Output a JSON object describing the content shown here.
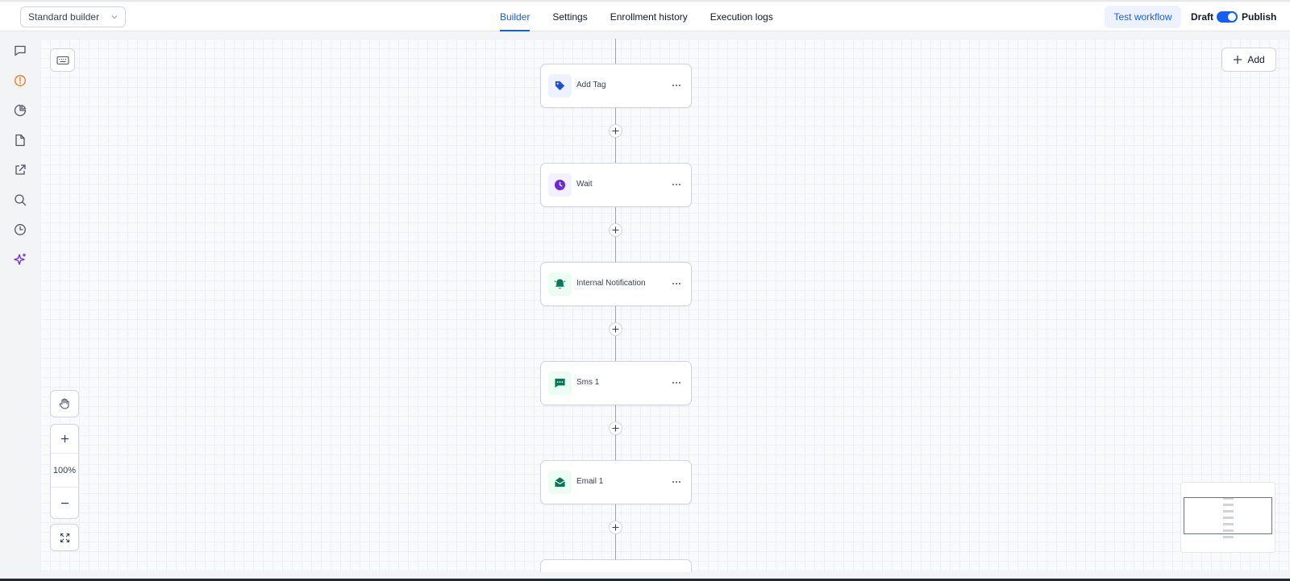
{
  "header": {
    "builder_select": "Standard builder",
    "tabs": [
      {
        "label": "Builder",
        "active": true
      },
      {
        "label": "Settings",
        "active": false
      },
      {
        "label": "Enrollment history",
        "active": false
      },
      {
        "label": "Execution logs",
        "active": false
      }
    ],
    "test_button": "Test workflow",
    "status_draft": "Draft",
    "status_publish": "Publish",
    "publish_toggle_on": true
  },
  "sidebar": {
    "icons": [
      "chat-icon",
      "alert-circle-icon",
      "pie-chart-icon",
      "file-icon",
      "external-link-icon",
      "search-icon",
      "history-icon",
      "sparkles-icon"
    ]
  },
  "canvas": {
    "add_button": "Add",
    "nodes": [
      {
        "label": "Add Tag",
        "icon": "tag-icon",
        "color": "#1d4ed8",
        "bg": "#eef2ff"
      },
      {
        "label": "Wait",
        "icon": "clock-icon",
        "color": "#6d28d9",
        "bg": "#f3f0ff"
      },
      {
        "label": "Internal Notification",
        "icon": "bell-icon",
        "color": "#047857",
        "bg": "#ecfdf3"
      },
      {
        "label": "Sms 1",
        "icon": "message-icon",
        "color": "#047857",
        "bg": "#ecfdf3"
      },
      {
        "label": "Email 1",
        "icon": "mail-icon",
        "color": "#047857",
        "bg": "#ecfdf3"
      }
    ]
  },
  "controls": {
    "zoom_level": "100%"
  },
  "colors": {
    "accent": "#155eef",
    "alert": "#f97316",
    "sparkle": "#6d28d9"
  }
}
